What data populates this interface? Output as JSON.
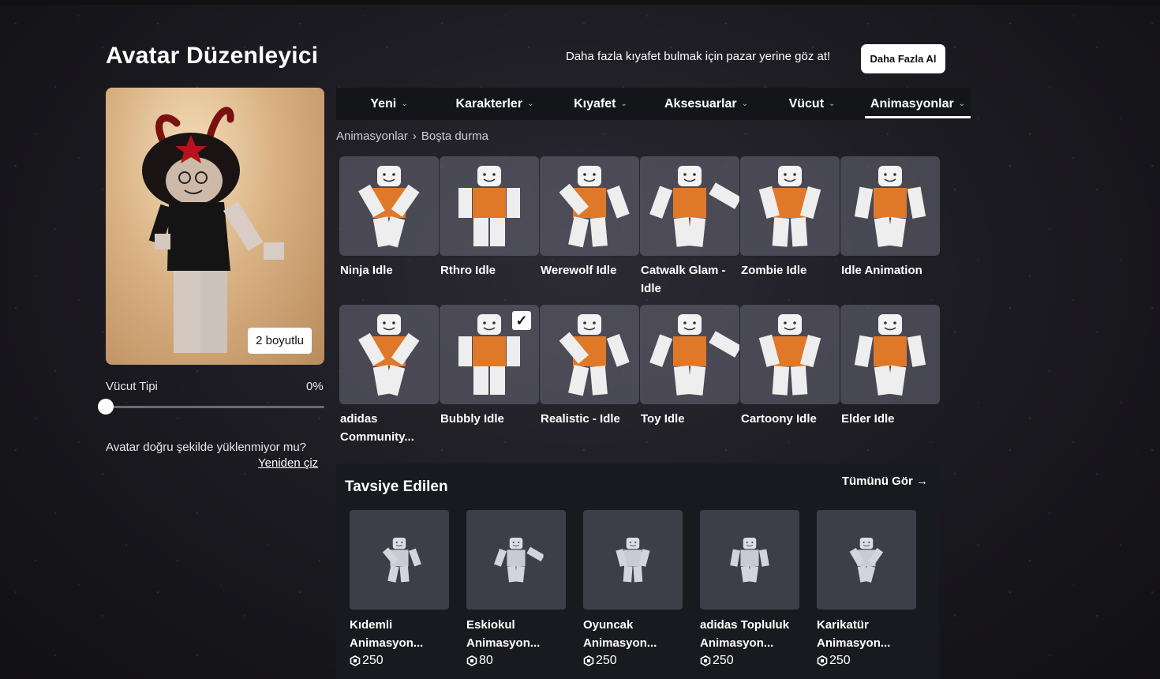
{
  "header": {
    "title": "Avatar Düzenleyici",
    "promo_text": "Daha fazla kıyafet bulmak için pazar yerine göz at!",
    "promo_button": "Daha Fazla Al"
  },
  "avatar": {
    "dimension_button": "2 boyutlu",
    "body_type_label": "Vücut Tipi",
    "body_type_value": "0%",
    "body_type_level": 0,
    "redraw_question": "Avatar doğru şekilde yüklenmiyor mu?",
    "redraw_link": "Yeniden çiz"
  },
  "tabs": [
    {
      "label": "Yeni"
    },
    {
      "label": "Karakterler"
    },
    {
      "label": "Kıyafet"
    },
    {
      "label": "Aksesuarlar"
    },
    {
      "label": "Vücut"
    },
    {
      "label": "Animasyonlar",
      "active": true
    }
  ],
  "breadcrumb": {
    "parent": "Animasyonlar",
    "current": "Boşta durma"
  },
  "items": [
    {
      "name": "Ninja Idle"
    },
    {
      "name": "Rthro Idle"
    },
    {
      "name": "Werewolf Idle"
    },
    {
      "name": "Catwalk Glam - Idle"
    },
    {
      "name": "Zombie Idle"
    },
    {
      "name": "Idle Animation"
    },
    {
      "name": "adidas Community..."
    },
    {
      "name": "Bubbly Idle",
      "selected": true
    },
    {
      "name": "Realistic - Idle"
    },
    {
      "name": "Toy Idle"
    },
    {
      "name": "Cartoony Idle"
    },
    {
      "name": "Elder Idle"
    }
  ],
  "recommended": {
    "title": "Tavsiye Edilen",
    "see_all": "Tümünü Gör",
    "items": [
      {
        "name": "Kıdemli Animasyon...",
        "price": "250"
      },
      {
        "name": "Eskiokul Animasyon...",
        "price": "80"
      },
      {
        "name": "Oyuncak Animasyon...",
        "price": "250"
      },
      {
        "name": "adidas Topluluk Animasyon...",
        "price": "250"
      },
      {
        "name": "Karikatür Animasyon...",
        "price": "250"
      }
    ]
  },
  "colors": {
    "accent_orange": "#e0782a",
    "panel": "#191a1f",
    "tab_bar": "#141519"
  }
}
